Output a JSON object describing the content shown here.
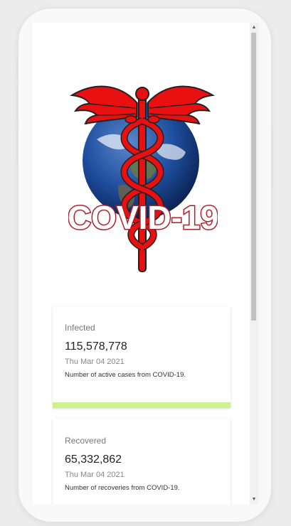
{
  "logo": {
    "text": "COVID-19"
  },
  "cards": [
    {
      "label": "Infected",
      "value": "115,578,778",
      "date": "Thu Mar 04 2021",
      "description": "Number of active cases from COVID-19.",
      "accent": "#ccf28c"
    },
    {
      "label": "Recovered",
      "value": "65,332,862",
      "date": "Thu Mar 04 2021",
      "description": "Number of recoveries from COVID-19.",
      "accent": "#ccf28c"
    }
  ],
  "colors": {
    "caduceus": "#e81010",
    "earth_ocean": "#1f4fa0",
    "logo_outline": "#b01e2a"
  },
  "scrollbar": {
    "up_icon": "▲",
    "down_icon": "▼"
  }
}
